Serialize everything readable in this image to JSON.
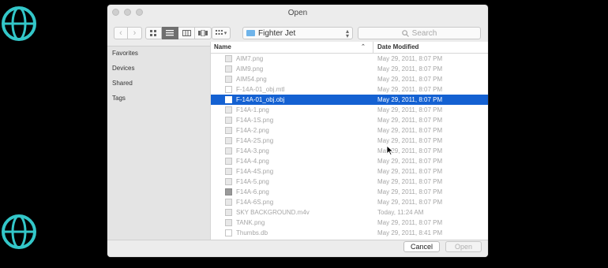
{
  "dialog": {
    "title": "Open",
    "path_popup": "Fighter Jet",
    "search_placeholder": "Search",
    "nav": {
      "back": "‹",
      "forward": "›"
    }
  },
  "sidebar": {
    "items": [
      {
        "label": "Favorites"
      },
      {
        "label": "Devices"
      },
      {
        "label": "Shared"
      },
      {
        "label": "Tags"
      }
    ]
  },
  "filelist": {
    "columns": {
      "name": "Name",
      "date": "Date Modified"
    },
    "selected_index": 4,
    "rows": [
      {
        "name": "AIM7.png",
        "date": "May 29, 2011, 8:07 PM",
        "icon": "image-file-icon"
      },
      {
        "name": "AIM9.png",
        "date": "May 29, 2011, 8:07 PM",
        "icon": "image-file-icon"
      },
      {
        "name": "AIM54.png",
        "date": "May 29, 2011, 8:07 PM",
        "icon": "image-file-icon"
      },
      {
        "name": "F-14A-01_obj.mtl",
        "date": "May 29, 2011, 8:07 PM",
        "icon": "document-file-icon"
      },
      {
        "name": "F-14A-01_obj.obj",
        "date": "May 29, 2011, 8:07 PM",
        "icon": "document-file-icon"
      },
      {
        "name": "F14A-1.png",
        "date": "May 29, 2011, 8:07 PM",
        "icon": "image-file-icon"
      },
      {
        "name": "F14A-1S.png",
        "date": "May 29, 2011, 8:07 PM",
        "icon": "image-file-icon"
      },
      {
        "name": "F14A-2.png",
        "date": "May 29, 2011, 8:07 PM",
        "icon": "image-file-icon"
      },
      {
        "name": "F14A-2S.png",
        "date": "May 29, 2011, 8:07 PM",
        "icon": "image-file-icon"
      },
      {
        "name": "F14A-3.png",
        "date": "May 29, 2011, 8:07 PM",
        "icon": "image-file-icon"
      },
      {
        "name": "F14A-4.png",
        "date": "May 29, 2011, 8:07 PM",
        "icon": "image-file-icon"
      },
      {
        "name": "F14A-4S.png",
        "date": "May 29, 2011, 8:07 PM",
        "icon": "image-file-icon"
      },
      {
        "name": "F14A-5.png",
        "date": "May 29, 2011, 8:07 PM",
        "icon": "image-file-icon"
      },
      {
        "name": "F14A-6.png",
        "date": "May 29, 2011, 8:07 PM",
        "icon": "image-file-icon-dark"
      },
      {
        "name": "F14A-6S.png",
        "date": "May 29, 2011, 8:07 PM",
        "icon": "image-file-icon"
      },
      {
        "name": "SKY BACKGROUND.m4v",
        "date": "Today, 11:24 AM",
        "icon": "video-file-icon"
      },
      {
        "name": "TANK.png",
        "date": "May 29, 2011, 8:07 PM",
        "icon": "image-file-icon"
      },
      {
        "name": "Thumbs.db",
        "date": "May 29, 2011, 8:41 PM",
        "icon": "document-file-icon"
      }
    ]
  },
  "buttons": {
    "cancel": "Cancel",
    "open": "Open"
  },
  "colors": {
    "selection": "#1461d2",
    "background_logo": "#33c7c9"
  }
}
